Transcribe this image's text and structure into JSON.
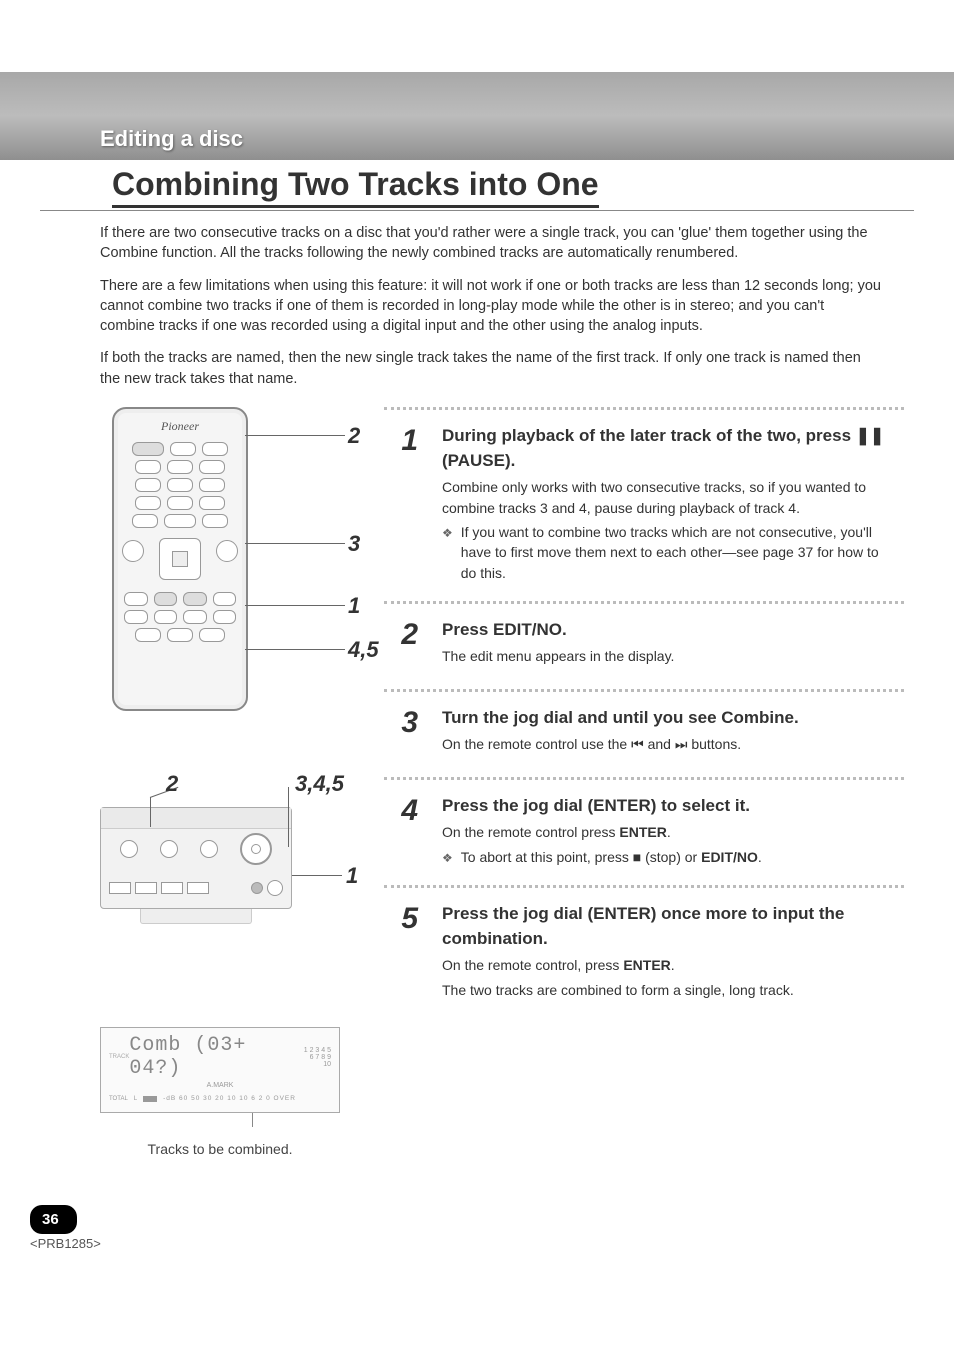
{
  "header": {
    "section": "Editing a disc"
  },
  "title": "Combining Two Tracks into One",
  "intro": {
    "p1": "If there are two consecutive tracks on a disc that you'd rather were a single track, you can 'glue' them together using the Combine function. All the tracks following the newly combined tracks are automatically renumbered.",
    "p2": "There are a few limitations when using this feature: it will not work if one or both tracks are less than 12 seconds long; you cannot combine two tracks if one of them is recorded in long-play mode while the other is in stereo; and you can't combine tracks if one was recorded using a digital input and the other using the analog inputs.",
    "p3": "If both the tracks are named, then the new single track takes the name of the first track. If only one track is named then the new track takes that name."
  },
  "leftFigures": {
    "remoteBrand": "Pioneer",
    "remoteCallouts": {
      "c2": "2",
      "c3": "3",
      "c1": "1",
      "c45": "4,5"
    },
    "deckCallouts": {
      "c2": "2",
      "c345": "3,4,5",
      "c1": "1"
    },
    "lcd": {
      "display": "Comb (03+ 04?)",
      "gridRow1": "1 2 3 4 5",
      "gridRow2": "6 7 8 9 10",
      "meterLabelLeft": "TOTAL",
      "amarkLabel": "A.MARK",
      "meterScale": "-dB 60 50   30   20   10 10   6    2    0 OVER",
      "caption": "Tracks to be combined."
    }
  },
  "steps": [
    {
      "num": "1",
      "head": "During playback of the later track of the two, press ❚❚ (PAUSE).",
      "body": "Combine only works with two consecutive tracks, so if you wanted to combine tracks 3 and 4, pause during playback of track 4.",
      "bullet": "If you want to combine two tracks which are not consecutive, you'll have to first move them next to each other—see page 37 for how to do this."
    },
    {
      "num": "2",
      "head": "Press EDIT/NO.",
      "body": "The edit menu appears in the display."
    },
    {
      "num": "3",
      "head": "Turn the jog dial and until you see Combine.",
      "body": "On the remote control use the ⏮ and ⏭ buttons."
    },
    {
      "num": "4",
      "head": "Press the jog dial (ENTER) to select it.",
      "body": "On the remote control press ENTER.",
      "bullet": "To abort at this point, press ■ (stop) or EDIT/NO."
    },
    {
      "num": "5",
      "head": "Press the jog dial (ENTER) once more to input the combination.",
      "body": "On the remote control, press ENTER.",
      "body2": "The two tracks are combined to form a single, long track."
    }
  ],
  "footer": {
    "pageNum": "36",
    "docRef": "<PRB1285>"
  }
}
